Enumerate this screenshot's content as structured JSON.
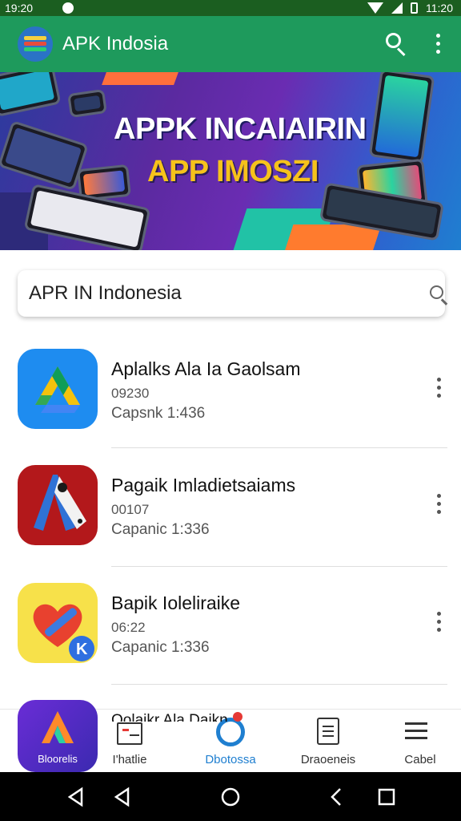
{
  "status_bar": {
    "time": "19:20",
    "battery": "11:20"
  },
  "app_bar": {
    "title": "APK Indosia"
  },
  "banner": {
    "line1": "APPK INCAIAIRIN",
    "line2": "APP IMOSZI"
  },
  "search": {
    "value": "APR IN Indonesia",
    "placeholder": ""
  },
  "apps": [
    {
      "name": "Aplalks Ala Ia Gaolsam",
      "size": "09230",
      "capacity": "Capsnk 1:436"
    },
    {
      "name": "Pagaik Imladietsaiams",
      "size": "00107",
      "capacity": "Capanic 1:336"
    },
    {
      "name": "Bapik Ioleliraike",
      "size": "06:22",
      "capacity": "Capanic 1:336"
    }
  ],
  "peek_item": {
    "name": "Oolaikr Ala Daikn"
  },
  "bottom_nav": [
    {
      "label": "Bloorelis",
      "icon": "app-logo-icon"
    },
    {
      "label": "I'hatlie",
      "icon": "card-icon"
    },
    {
      "label": "Dbotossa",
      "icon": "app-badge-icon"
    },
    {
      "label": "Draoeneis",
      "icon": "document-icon"
    },
    {
      "label": "Cabel",
      "icon": "menu-icon"
    }
  ],
  "colors": {
    "app_bar": "#1e9a5c",
    "status_bar": "#1b5e20",
    "accent": "#1f7fd0"
  }
}
